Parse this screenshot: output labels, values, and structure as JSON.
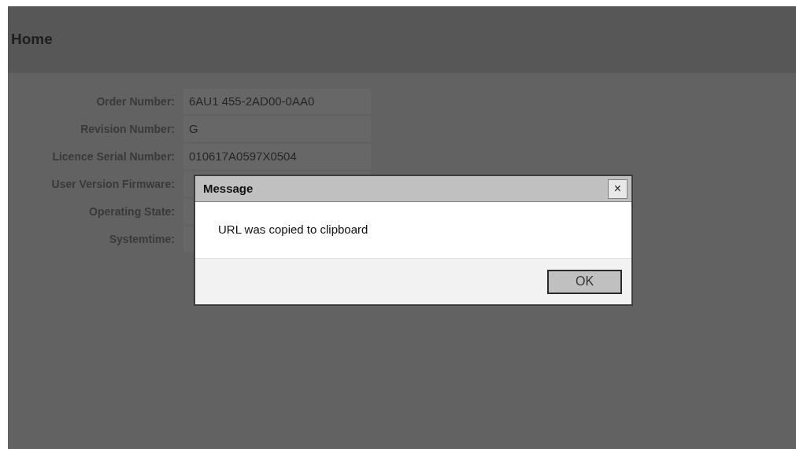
{
  "page": {
    "title": "Home"
  },
  "fields": [
    {
      "label": "Order Number:",
      "value": "6AU1 455-2AD00-0AA0"
    },
    {
      "label": "Revision Number:",
      "value": "G"
    },
    {
      "label": "Licence Serial Number:",
      "value": "010617A0597X0504"
    },
    {
      "label": "User Version Firmware:"
    },
    {
      "label": "Operating State:"
    },
    {
      "label": "Systemtime:"
    }
  ],
  "dialog": {
    "title": "Message",
    "close": "×",
    "message": "URL was copied to clipboard",
    "buttons": [
      "OK"
    ]
  }
}
